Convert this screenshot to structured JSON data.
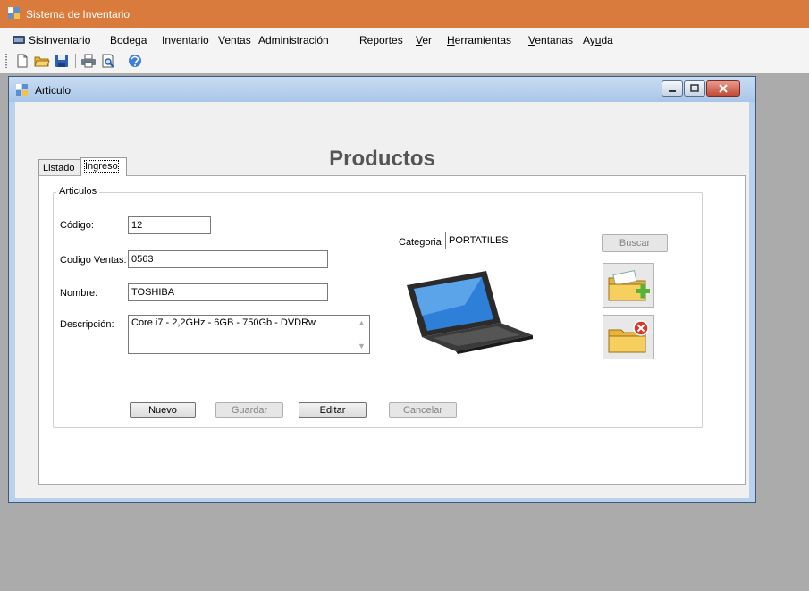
{
  "app": {
    "title": "Sistema de Inventario"
  },
  "menu": {
    "items": [
      {
        "label": "SisInventario"
      },
      {
        "label": "Bodega"
      },
      {
        "label": "Inventario"
      },
      {
        "label": "Ventas"
      },
      {
        "label": "Administración"
      },
      {
        "label": "Reportes"
      },
      {
        "pre": "",
        "mn": "V",
        "post": "er"
      },
      {
        "pre": "",
        "mn": "H",
        "post": "erramientas"
      },
      {
        "pre": "",
        "mn": "V",
        "post": "entanas"
      },
      {
        "pre": "Ay",
        "mn": "u",
        "post": "da"
      }
    ]
  },
  "toolbar": {
    "icons": [
      "new-file-icon",
      "open-folder-icon",
      "save-icon",
      "print-icon",
      "print-preview-icon",
      "help-icon"
    ]
  },
  "child": {
    "title": "Articulo"
  },
  "page": {
    "title": "Productos"
  },
  "tabs": [
    {
      "label": "Listado",
      "active": false
    },
    {
      "label": "Ingreso",
      "active": true
    }
  ],
  "form": {
    "group_title": "Articulos",
    "codigo": {
      "label": "Código:",
      "value": "12"
    },
    "codigo_ventas": {
      "label": "Codigo Ventas:",
      "value": "0563"
    },
    "nombre": {
      "label": "Nombre:",
      "value": "TOSHIBA"
    },
    "descripcion": {
      "label": "Descripción:",
      "value": "Core i7 - 2,2GHz - 6GB - 750Gb - DVDRw"
    },
    "categoria": {
      "label": "Categoria",
      "value": "PORTATILES"
    },
    "buscar_label": "Buscar",
    "buttons": {
      "nuevo": "Nuevo",
      "guardar": "Guardar",
      "editar": "Editar",
      "cancelar": "Cancelar"
    }
  },
  "colors": {
    "app_titlebar": "#d87b3c",
    "mdi_background": "#ababab",
    "child_titlebar": "#b9d1ea",
    "title_text": "#555555"
  }
}
